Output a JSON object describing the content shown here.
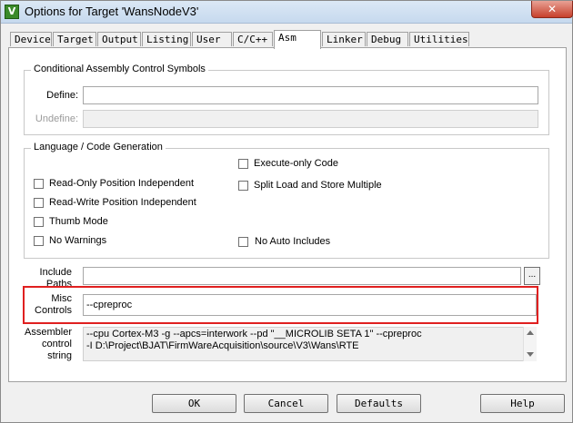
{
  "window": {
    "title": "Options for Target 'WansNodeV3'",
    "close_glyph": "✕",
    "app_icon_glyph": "V"
  },
  "tabs": [
    {
      "label": "Device"
    },
    {
      "label": "Target"
    },
    {
      "label": "Output"
    },
    {
      "label": "Listing"
    },
    {
      "label": "User"
    },
    {
      "label": "C/C++"
    },
    {
      "label": "Asm"
    },
    {
      "label": "Linker"
    },
    {
      "label": "Debug"
    },
    {
      "label": "Utilities"
    }
  ],
  "active_tab": "Asm",
  "conditional": {
    "title": "Conditional Assembly Control Symbols",
    "define_label": "Define:",
    "define_value": "",
    "undefine_label": "Undefine:",
    "undefine_value": ""
  },
  "language": {
    "title": "Language / Code Generation",
    "execute_only": "Execute-only Code",
    "read_only_pi": "Read-Only Position Independent",
    "split_load_store": "Split Load and Store Multiple",
    "read_write_pi": "Read-Write Position Independent",
    "thumb_mode": "Thumb Mode",
    "no_warnings": "No Warnings",
    "no_auto_includes": "No Auto Includes"
  },
  "include": {
    "label": "Include Paths",
    "value": "",
    "browse_label": "..."
  },
  "misc": {
    "label": "Misc Controls",
    "value": "--cpreproc"
  },
  "assembler": {
    "label": "Assembler control string",
    "line1": "--cpu Cortex-M3 -g --apcs=interwork --pd \"__MICROLIB SETA 1\" --cpreproc",
    "line2": "-I D:\\Project\\BJAT\\FirmWareAcquisition\\source\\V3\\Wans\\RTE"
  },
  "buttons": {
    "ok": "OK",
    "cancel": "Cancel",
    "defaults": "Defaults",
    "help": "Help"
  }
}
